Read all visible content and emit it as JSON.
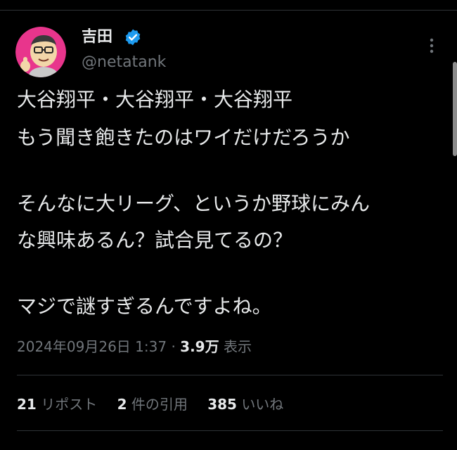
{
  "tweet": {
    "author": {
      "display_name": "吉田",
      "handle": "@netatank",
      "verified": true,
      "verified_color": "#1d9bf0"
    },
    "more_icon": "more-vertical-icon",
    "lines": [
      "大谷翔平・大谷翔平・大谷翔平",
      "もう聞き飽きたのはワイだけだろうか",
      "そんなに大リーグ、というか野球にみん",
      "な興味あるん？試合見てるの？",
      "マジで謎すぎるんですよね。"
    ],
    "timestamp": "2024年09月26日 1:37",
    "separator": "·",
    "views_count": "3.9万",
    "views_label": "表示",
    "stats": {
      "reposts_count": "21",
      "reposts_label": "リポスト",
      "quotes_count": "2",
      "quotes_label": "件の引用",
      "likes_count": "385",
      "likes_label": "いいね"
    }
  },
  "colors": {
    "background": "#000000",
    "primary_text": "#e7e9ea",
    "secondary_text": "#71767b",
    "divider": "#2f3336",
    "avatar_bg": "#e8358c"
  }
}
